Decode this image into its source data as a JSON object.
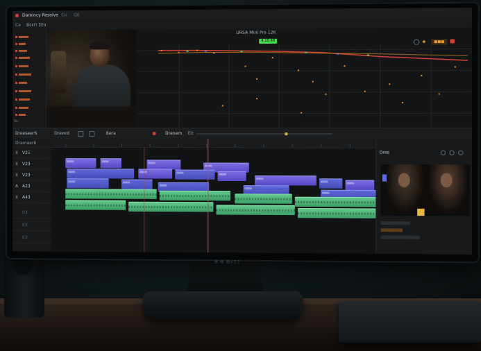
{
  "app": {
    "title": "Dareincy Resolve",
    "menu_a": "Cu",
    "menu_b": "ΩE"
  },
  "menubar": {
    "left_a": "Ca",
    "left_b": "Βεε⊓ ΣEα"
  },
  "viewer": {
    "clip_title": "URSA Mini Pro 12K",
    "badge": "4:15:48"
  },
  "media_tree": {
    "footer": "Sυ"
  },
  "transport": {
    "label_left": "Dreeseer6",
    "label_2": "Drewrd",
    "play_label": "Bera",
    "timecode": "Drenem",
    "timecode_suffix": "Eit"
  },
  "tracks": [
    {
      "icon": "X",
      "name": "V2Ξ"
    },
    {
      "icon": "X",
      "name": "V23"
    },
    {
      "icon": "X",
      "name": "V23"
    },
    {
      "icon": "A",
      "name": "A23"
    },
    {
      "icon": "X",
      "name": "A43"
    },
    {
      "icon": "",
      "name": "03",
      "dim": true
    },
    {
      "icon": "",
      "name": "E3",
      "dim": true
    },
    {
      "icon": "",
      "name": "E3",
      "dim": true
    }
  ],
  "track_header_top": "Dramaer6",
  "inspector": {
    "title": "Dres"
  },
  "monitor": {
    "brand": "θ Θ Θ√ΞΞ"
  },
  "colors": {
    "accent_red": "#d8433a",
    "accent_orange": "#f0a236",
    "video_clip": "#6a5de0",
    "audio_clip": "#4fb67a",
    "badge_green": "#48d84f"
  }
}
